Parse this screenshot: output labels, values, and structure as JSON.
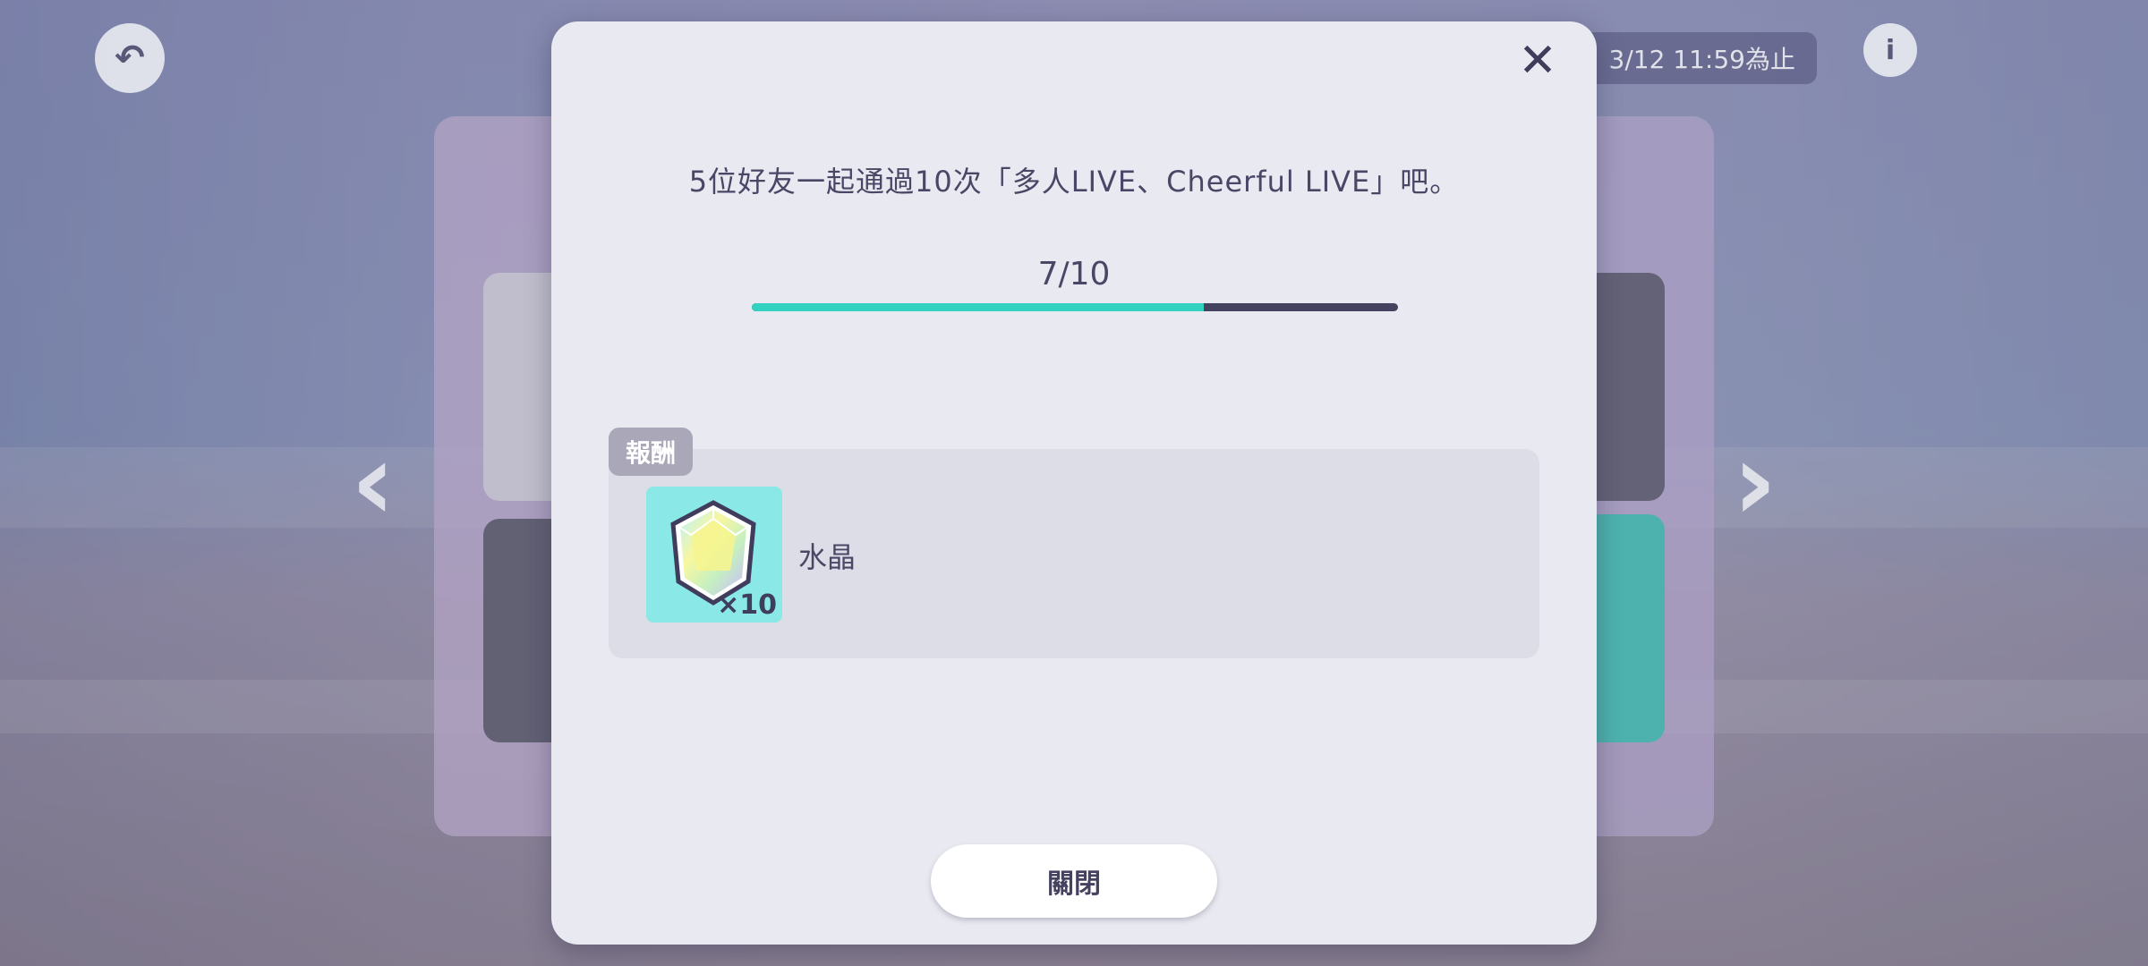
{
  "background": {
    "deadline_text": "3/12 11:59為止"
  },
  "dialog": {
    "mission_text": "5位好友一起通過10次「多人LIVE、Cheerful LIVE」吧。",
    "progress_label": "7/10",
    "progress_fraction": 0.7,
    "reward_tag": "報酬",
    "reward": {
      "icon": "crystal-icon",
      "quantity": "×10",
      "name": "水晶"
    },
    "close_button_label": "關閉"
  },
  "colors": {
    "dialog_bg": "#e9e9f1",
    "progress_fill": "#33d1c0",
    "progress_track": "#45425f",
    "reward_box": "#dddde8",
    "reward_tag": "#a9a7b8",
    "reward_icon_bg": "#8ae8e6",
    "text": "#4a4766"
  }
}
